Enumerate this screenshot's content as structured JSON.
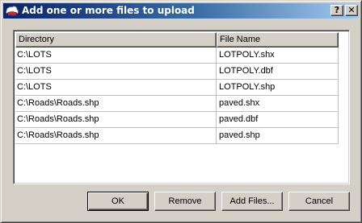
{
  "window": {
    "title": "Add one or more files to upload",
    "help_label": "?",
    "close_label": "✕",
    "icon": "upload-app-icon"
  },
  "list": {
    "columns": [
      "Directory",
      "File Name"
    ],
    "rows": [
      {
        "directory": "C:\\LOTS",
        "file_name": "LOTPOLY.shx"
      },
      {
        "directory": "C:\\LOTS",
        "file_name": "LOTPOLY.dbf"
      },
      {
        "directory": "C:\\LOTS",
        "file_name": "LOTPOLY.shp"
      },
      {
        "directory": "C:\\Roads\\Roads.shp",
        "file_name": "paved.shx"
      },
      {
        "directory": "C:\\Roads\\Roads.shp",
        "file_name": "paved.dbf"
      },
      {
        "directory": "C:\\Roads\\Roads.shp",
        "file_name": "paved.shp"
      }
    ]
  },
  "buttons": {
    "ok": "OK",
    "remove": "Remove",
    "add_files": "Add Files...",
    "cancel": "Cancel"
  }
}
